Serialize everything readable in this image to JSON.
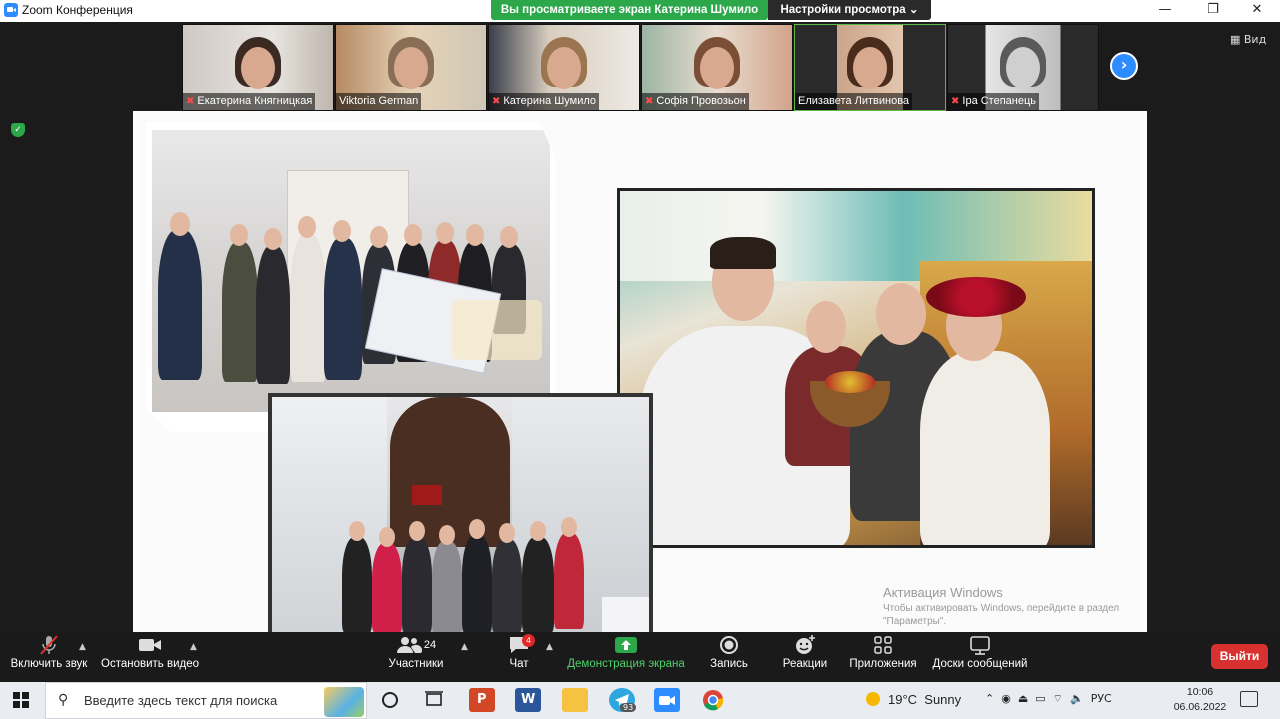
{
  "window": {
    "title": "Zoom Конференция",
    "minimize": "—",
    "maximize": "❐",
    "close": "✕"
  },
  "share_banner": {
    "text": "Вы просматриваете экран Катерина Шумило",
    "view_options": "Настройки просмотра ⌄"
  },
  "participants_strip": [
    {
      "name": "Екатерина Княгницкая",
      "muted": true
    },
    {
      "name": "Viktoria German",
      "muted": false
    },
    {
      "name": "Катерина Шумило",
      "muted": true
    },
    {
      "name": "Софія Провозьон",
      "muted": true
    },
    {
      "name": "Елизавета Литвинова",
      "muted": false,
      "active": true
    },
    {
      "name": "Іра Степанець",
      "muted": true
    }
  ],
  "view_button": "Вид",
  "watermark": {
    "title": "Активация Windows",
    "text": "Чтобы активировать Windows, перейдите в раздел \"Параметры\"."
  },
  "toolbar": {
    "unmute": "Включить звук",
    "stop_video": "Остановить видео",
    "participants": "Участники",
    "participants_count": "24",
    "chat": "Чат",
    "chat_badge": "4",
    "share": "Демонстрация экрана",
    "record": "Запись",
    "reactions": "Реакции",
    "apps": "Приложения",
    "whiteboards": "Доски сообщений",
    "leave": "Выйти"
  },
  "taskbar": {
    "search_placeholder": "Введите здесь текст для поиска",
    "telegram_badge": "93",
    "weather_temp": "19°C",
    "weather_desc": "Sunny",
    "language": "РУС",
    "time": "10:06",
    "date": "06.06.2022"
  },
  "colors": {
    "zoom_blue": "#2d8cff",
    "share_green": "#2ca84b",
    "leave_red": "#d9312f"
  }
}
